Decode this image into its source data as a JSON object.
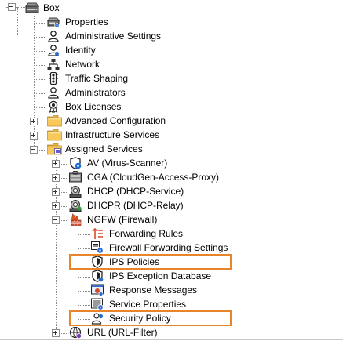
{
  "tree": {
    "root": {
      "label": "Box",
      "icon": "server-box-icon"
    },
    "box_children": [
      {
        "label": "Properties",
        "icon": "properties-icon"
      },
      {
        "label": "Administrative Settings",
        "icon": "admin-settings-icon"
      },
      {
        "label": "Identity",
        "icon": "identity-icon"
      },
      {
        "label": "Network",
        "icon": "network-icon"
      },
      {
        "label": "Traffic Shaping",
        "icon": "traffic-light-icon"
      },
      {
        "label": "Administrators",
        "icon": "administrators-icon"
      },
      {
        "label": "Box Licenses",
        "icon": "license-icon"
      },
      {
        "label": "Advanced Configuration",
        "icon": "folder-icon"
      },
      {
        "label": "Infrastructure Services",
        "icon": "folder-icon"
      },
      {
        "label": "Assigned Services",
        "icon": "folder-services-icon"
      }
    ],
    "services": [
      {
        "label": "AV (Virus-Scanner)",
        "icon": "virus-scanner-icon"
      },
      {
        "label": "CGA (CloudGen-Access-Proxy)",
        "icon": "cloudgen-access-icon"
      },
      {
        "label": "DHCP (DHCP-Service)",
        "icon": "dhcp-icon"
      },
      {
        "label": "DHCPR (DHCP-Relay)",
        "icon": "dhcp-relay-icon"
      },
      {
        "label": "NGFW (Firewall)",
        "icon": "firewall-icon"
      },
      {
        "label": "URL (URL-Filter)",
        "icon": "url-filter-icon"
      }
    ],
    "firewall_children": [
      {
        "label": "Forwarding Rules",
        "icon": "forwarding-rules-icon"
      },
      {
        "label": "Firewall Forwarding Settings",
        "icon": "forwarding-settings-icon"
      },
      {
        "label": "IPS Policies",
        "icon": "ips-shield-icon"
      },
      {
        "label": "IPS Exception Database",
        "icon": "ips-exception-icon"
      },
      {
        "label": "Response Messages",
        "icon": "response-messages-icon"
      },
      {
        "label": "Service Properties",
        "icon": "service-properties-icon"
      },
      {
        "label": "Security Policy",
        "icon": "security-policy-icon"
      }
    ]
  },
  "highlight_color": "#e8852c"
}
